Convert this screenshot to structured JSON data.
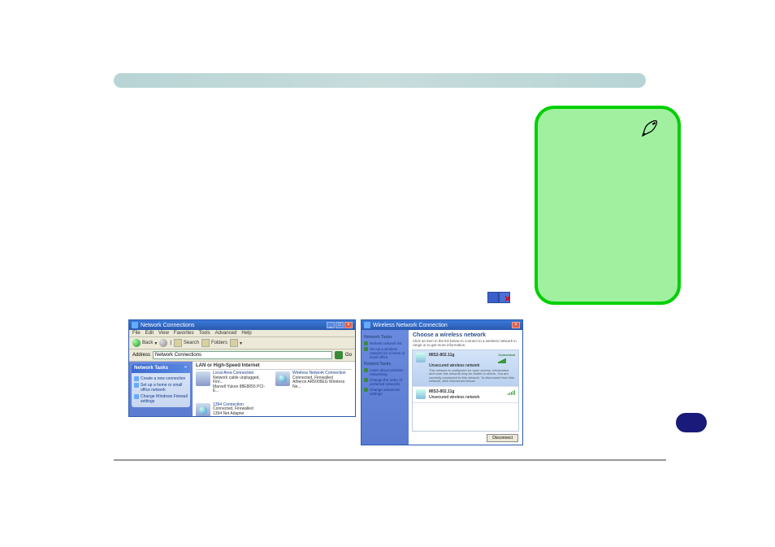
{
  "note": {
    "icon": "pen-icon"
  },
  "tray": {
    "icon": "network-disconnected-icon"
  },
  "leftWindow": {
    "title": "Network Connections",
    "menu": [
      "File",
      "Edit",
      "View",
      "Favorites",
      "Tools",
      "Advanced",
      "Help"
    ],
    "toolbar": {
      "back": "Back",
      "search": "Search",
      "folders": "Folders"
    },
    "address": {
      "label": "Address",
      "value": "Network Connections",
      "go": "Go"
    },
    "tasks": {
      "header": "Network Tasks",
      "items": [
        "Create a new connection",
        "Set up a home or small office network",
        "Change Windows Firewall settings"
      ]
    },
    "groupHeader": "LAN or High-Speed Internet",
    "connections": [
      {
        "name": "Local Area Connection",
        "status": "Network cable unplugged, Fire...",
        "device": "Marvell Yukon 88E8055 PCI-E..."
      },
      {
        "name": "Wireless Network Connection",
        "status": "Connected, Firewalled",
        "device": "Atheros AR5006EG Wireless Ne..."
      },
      {
        "name": "1394 Connection",
        "status": "Connected, Firewalled",
        "device": "1394 Net Adapter"
      }
    ]
  },
  "rightWindow": {
    "title": "Wireless Network Connection",
    "side": {
      "h1": "Network Tasks",
      "i1": "Refresh network list",
      "i2": "Set up a wireless network for a home or small office",
      "h2": "Related Tasks",
      "i3": "Learn about wireless networking",
      "i4": "Change the order of preferred networks",
      "i5": "Change advanced settings"
    },
    "main": {
      "heading": "Choose a wireless network",
      "sub": "Click an item in the list below to connect to a wireless network in range or to get more information.",
      "networks": [
        {
          "ssid": "MIS2-802.11g",
          "status": "Connected",
          "type": "Unsecured wireless network",
          "desc": "This network is configured for open access. Information sent over this network may be visible to others. You are currently connected to this network. To disconnect from this network, click Disconnect below."
        },
        {
          "ssid": "MIS3-802.11g",
          "status": "",
          "type": "Unsecured wireless network",
          "desc": ""
        }
      ],
      "button": "Disconnect"
    }
  }
}
